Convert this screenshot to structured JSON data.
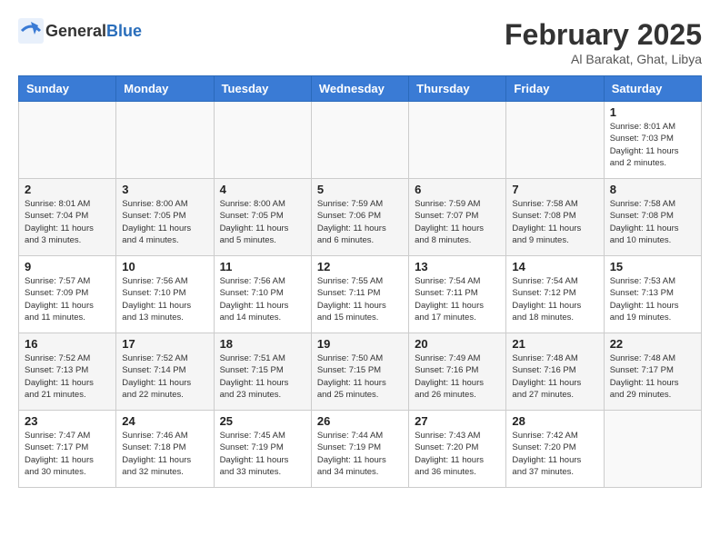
{
  "header": {
    "logo_general": "General",
    "logo_blue": "Blue",
    "title": "February 2025",
    "subtitle": "Al Barakat, Ghat, Libya"
  },
  "calendar": {
    "days_of_week": [
      "Sunday",
      "Monday",
      "Tuesday",
      "Wednesday",
      "Thursday",
      "Friday",
      "Saturday"
    ],
    "weeks": [
      [
        {
          "day": "",
          "info": ""
        },
        {
          "day": "",
          "info": ""
        },
        {
          "day": "",
          "info": ""
        },
        {
          "day": "",
          "info": ""
        },
        {
          "day": "",
          "info": ""
        },
        {
          "day": "",
          "info": ""
        },
        {
          "day": "1",
          "info": "Sunrise: 8:01 AM\nSunset: 7:03 PM\nDaylight: 11 hours and 2 minutes."
        }
      ],
      [
        {
          "day": "2",
          "info": "Sunrise: 8:01 AM\nSunset: 7:04 PM\nDaylight: 11 hours and 3 minutes."
        },
        {
          "day": "3",
          "info": "Sunrise: 8:00 AM\nSunset: 7:05 PM\nDaylight: 11 hours and 4 minutes."
        },
        {
          "day": "4",
          "info": "Sunrise: 8:00 AM\nSunset: 7:05 PM\nDaylight: 11 hours and 5 minutes."
        },
        {
          "day": "5",
          "info": "Sunrise: 7:59 AM\nSunset: 7:06 PM\nDaylight: 11 hours and 6 minutes."
        },
        {
          "day": "6",
          "info": "Sunrise: 7:59 AM\nSunset: 7:07 PM\nDaylight: 11 hours and 8 minutes."
        },
        {
          "day": "7",
          "info": "Sunrise: 7:58 AM\nSunset: 7:08 PM\nDaylight: 11 hours and 9 minutes."
        },
        {
          "day": "8",
          "info": "Sunrise: 7:58 AM\nSunset: 7:08 PM\nDaylight: 11 hours and 10 minutes."
        }
      ],
      [
        {
          "day": "9",
          "info": "Sunrise: 7:57 AM\nSunset: 7:09 PM\nDaylight: 11 hours and 11 minutes."
        },
        {
          "day": "10",
          "info": "Sunrise: 7:56 AM\nSunset: 7:10 PM\nDaylight: 11 hours and 13 minutes."
        },
        {
          "day": "11",
          "info": "Sunrise: 7:56 AM\nSunset: 7:10 PM\nDaylight: 11 hours and 14 minutes."
        },
        {
          "day": "12",
          "info": "Sunrise: 7:55 AM\nSunset: 7:11 PM\nDaylight: 11 hours and 15 minutes."
        },
        {
          "day": "13",
          "info": "Sunrise: 7:54 AM\nSunset: 7:11 PM\nDaylight: 11 hours and 17 minutes."
        },
        {
          "day": "14",
          "info": "Sunrise: 7:54 AM\nSunset: 7:12 PM\nDaylight: 11 hours and 18 minutes."
        },
        {
          "day": "15",
          "info": "Sunrise: 7:53 AM\nSunset: 7:13 PM\nDaylight: 11 hours and 19 minutes."
        }
      ],
      [
        {
          "day": "16",
          "info": "Sunrise: 7:52 AM\nSunset: 7:13 PM\nDaylight: 11 hours and 21 minutes."
        },
        {
          "day": "17",
          "info": "Sunrise: 7:52 AM\nSunset: 7:14 PM\nDaylight: 11 hours and 22 minutes."
        },
        {
          "day": "18",
          "info": "Sunrise: 7:51 AM\nSunset: 7:15 PM\nDaylight: 11 hours and 23 minutes."
        },
        {
          "day": "19",
          "info": "Sunrise: 7:50 AM\nSunset: 7:15 PM\nDaylight: 11 hours and 25 minutes."
        },
        {
          "day": "20",
          "info": "Sunrise: 7:49 AM\nSunset: 7:16 PM\nDaylight: 11 hours and 26 minutes."
        },
        {
          "day": "21",
          "info": "Sunrise: 7:48 AM\nSunset: 7:16 PM\nDaylight: 11 hours and 27 minutes."
        },
        {
          "day": "22",
          "info": "Sunrise: 7:48 AM\nSunset: 7:17 PM\nDaylight: 11 hours and 29 minutes."
        }
      ],
      [
        {
          "day": "23",
          "info": "Sunrise: 7:47 AM\nSunset: 7:17 PM\nDaylight: 11 hours and 30 minutes."
        },
        {
          "day": "24",
          "info": "Sunrise: 7:46 AM\nSunset: 7:18 PM\nDaylight: 11 hours and 32 minutes."
        },
        {
          "day": "25",
          "info": "Sunrise: 7:45 AM\nSunset: 7:19 PM\nDaylight: 11 hours and 33 minutes."
        },
        {
          "day": "26",
          "info": "Sunrise: 7:44 AM\nSunset: 7:19 PM\nDaylight: 11 hours and 34 minutes."
        },
        {
          "day": "27",
          "info": "Sunrise: 7:43 AM\nSunset: 7:20 PM\nDaylight: 11 hours and 36 minutes."
        },
        {
          "day": "28",
          "info": "Sunrise: 7:42 AM\nSunset: 7:20 PM\nDaylight: 11 hours and 37 minutes."
        },
        {
          "day": "",
          "info": ""
        }
      ]
    ]
  }
}
